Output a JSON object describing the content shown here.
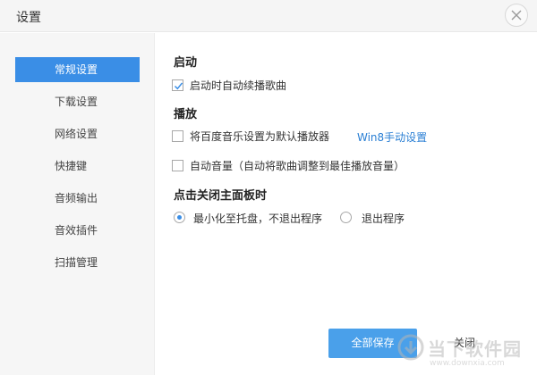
{
  "window": {
    "title": "设置"
  },
  "sidebar": {
    "items": [
      {
        "label": "常规设置",
        "active": true
      },
      {
        "label": "下载设置",
        "active": false
      },
      {
        "label": "网络设置",
        "active": false
      },
      {
        "label": "快捷键",
        "active": false
      },
      {
        "label": "音频输出",
        "active": false
      },
      {
        "label": "音效插件",
        "active": false
      },
      {
        "label": "扫描管理",
        "active": false
      }
    ]
  },
  "sections": {
    "startup": {
      "title": "启动",
      "auto_resume": {
        "label": "启动时自动续播歌曲",
        "checked": true
      }
    },
    "playback": {
      "title": "播放",
      "default_player": {
        "label": "将百度音乐设置为默认播放器",
        "checked": false
      },
      "win8_link": "Win8手动设置",
      "auto_volume": {
        "label": "自动音量（自动将歌曲调整到最佳播放音量）",
        "checked": false
      }
    },
    "close_panel": {
      "title": "点击关闭主面板时",
      "options": [
        {
          "label": "最小化至托盘，不退出程序",
          "selected": true
        },
        {
          "label": "退出程序",
          "selected": false
        }
      ]
    }
  },
  "footer": {
    "save_label": "全部保存",
    "close_label": "关闭"
  },
  "watermark": {
    "text": "当下软件园",
    "url": "www.downxia.com"
  },
  "colors": {
    "accent": "#3a8ee6",
    "save_button": "#4aa0ea",
    "link": "#2a7fd4"
  },
  "icons": {
    "close": "close-icon",
    "check": "checkmark-icon"
  }
}
